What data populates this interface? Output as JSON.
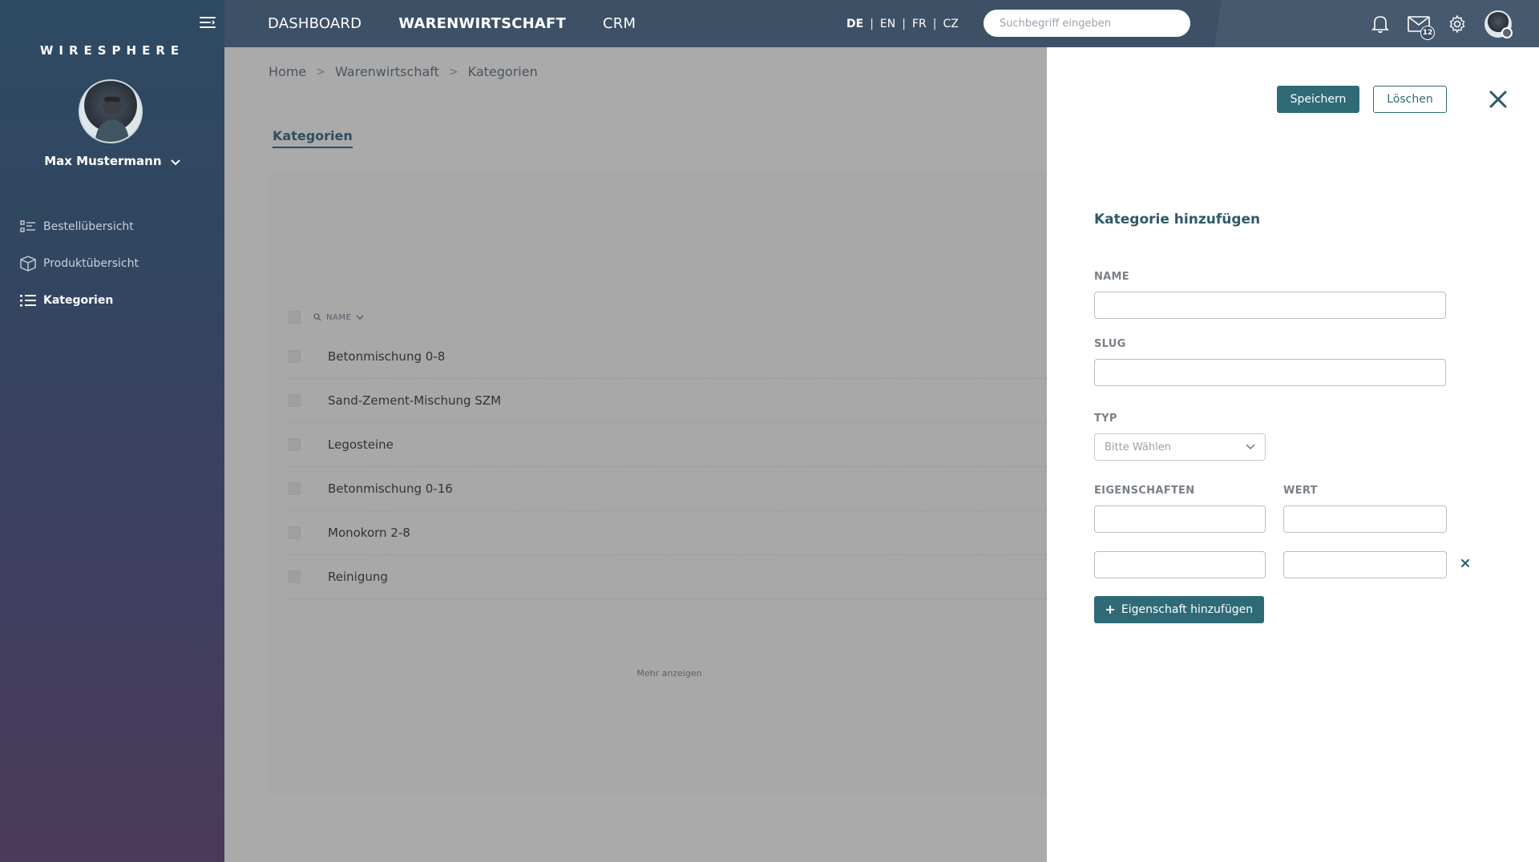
{
  "sidebar": {
    "brand": "WIRESPHERE",
    "user_name": "Max Mustermann",
    "items": [
      {
        "label": "Bestellübersicht",
        "icon": "list-detail-icon"
      },
      {
        "label": "Produktübersicht",
        "icon": "box-icon"
      },
      {
        "label": "Kategorien",
        "icon": "list-icon"
      }
    ]
  },
  "topbar": {
    "nav": [
      "DASHBOARD",
      "WARENWIRTSCHAFT",
      "CRM"
    ],
    "active_nav": "WARENWIRTSCHAFT",
    "languages": [
      "DE",
      "EN",
      "FR",
      "CZ"
    ],
    "active_language": "DE",
    "search_placeholder": "Suchbegriff eingeben",
    "mail_count": "12"
  },
  "breadcrumb": [
    "Home",
    "Warenwirtschaft",
    "Kategorien"
  ],
  "page_tab": "Kategorien",
  "table": {
    "column_name": "NAME",
    "rows": [
      "Betonmischung 0-8",
      "Sand-Zement-Mischung SZM",
      "Legosteine",
      "Betonmischung 0-16",
      "Monokorn 2-8",
      "Reinigung"
    ],
    "more_label": "Mehr anzeigen"
  },
  "panel": {
    "save_label": "Speichern",
    "delete_label": "Löschen",
    "title": "Kategorie hinzufügen",
    "name_label": "NAME",
    "slug_label": "SLUG",
    "type_label": "TYP",
    "type_placeholder": "Bitte Wählen",
    "props_label": "EIGENSCHAFTEN",
    "value_label": "WERT",
    "add_property_label": "Eigenschaft hinzufügen"
  },
  "colors": {
    "accent": "#2f6b77",
    "topbar": "#3e5066",
    "overlay": "#aaaaaa"
  }
}
